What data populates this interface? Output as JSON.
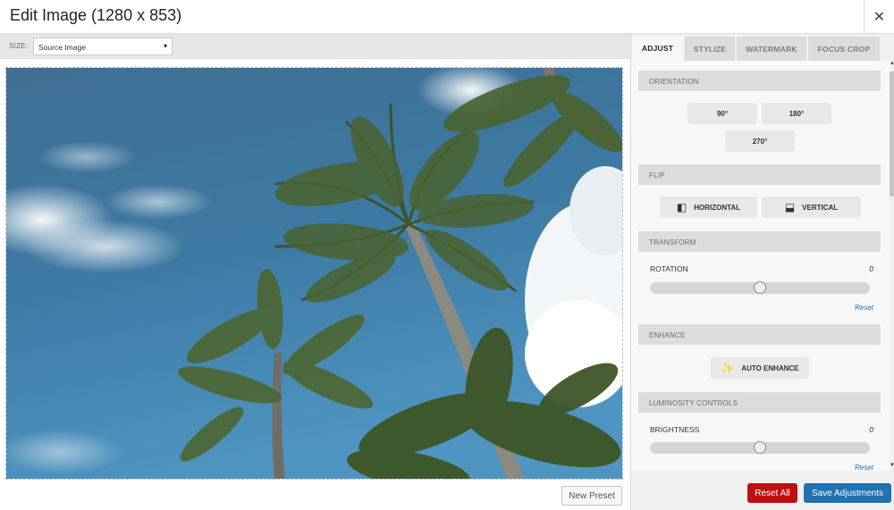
{
  "header": {
    "title": "Edit Image (1280 x 853)",
    "close_glyph": "✕"
  },
  "size": {
    "label": "SIZE:",
    "selected": "Source Image",
    "caret": "▾"
  },
  "image": {
    "alt": "palm trees against blue sky"
  },
  "new_preset_label": "New Preset",
  "tabs": [
    {
      "label": "ADJUST",
      "active": true
    },
    {
      "label": "STYLIZE",
      "active": false
    },
    {
      "label": "WATERMARK",
      "active": false
    },
    {
      "label": "FOCUS CROP",
      "active": false
    }
  ],
  "orientation": {
    "heading": "ORIENTATION",
    "buttons": [
      "90°",
      "180°",
      "270°"
    ]
  },
  "flip": {
    "heading": "FLIP",
    "horizontal": "HORIZONTAL",
    "vertical": "VERTICAL"
  },
  "transform": {
    "heading": "TRANSFORM",
    "rotation_label": "ROTATION",
    "rotation_value": "0",
    "reset": "Reset",
    "rotation_level": 0.5
  },
  "enhance": {
    "heading": "ENHANCE",
    "auto_label": "AUTO ENHANCE"
  },
  "luminosity": {
    "heading": "LUMINOSITY CONTROLS",
    "brightness_label": "BRIGHTNESS",
    "brightness_value": "0",
    "reset": "Reset",
    "brightness_level": 0.5
  },
  "footer": {
    "reset_all": "Reset All",
    "save": "Save Adjustments"
  },
  "colors": {
    "reset_all_bg": "#c20e11",
    "save_bg": "#2271b1",
    "link": "#2271b1"
  }
}
